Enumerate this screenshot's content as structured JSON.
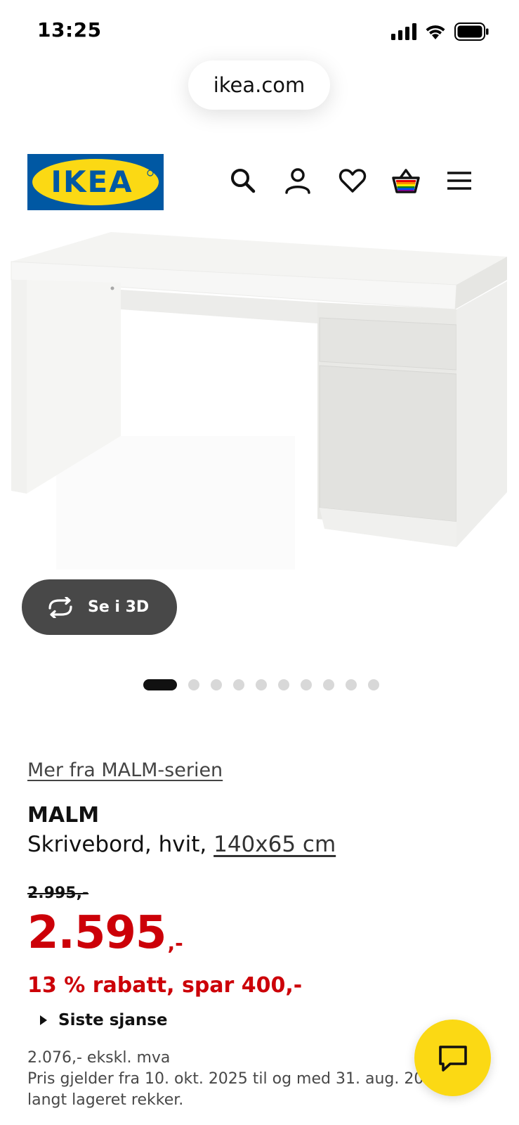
{
  "status_bar": {
    "time": "13:25",
    "icons": [
      "signal-icon",
      "wifi-icon",
      "battery-icon"
    ]
  },
  "browser": {
    "url": "ikea.com"
  },
  "header": {
    "logo_text": "IKEA",
    "logo_colors": {
      "background": "#0058a3",
      "oval": "#fbd914",
      "text": "#0058a3"
    },
    "nav_icons": [
      "search-icon",
      "account-icon",
      "heart-icon",
      "basket-icon",
      "menu-icon"
    ]
  },
  "gallery": {
    "view_3d_label": "Se i 3D",
    "dot_count": 10,
    "active_index": 0
  },
  "product": {
    "series_link": "Mer fra MALM-serien",
    "name": "MALM",
    "description_prefix": "Skrivebord, hvit, ",
    "size_link": "140x65 cm",
    "old_price": "2.995,-",
    "price_main": "2.595",
    "price_suffix": ",-",
    "discount_text": "13 % rabatt, spar 400,-",
    "last_chance_label": "Siste sjanse",
    "excl_vat": "2.076,- ekskl. mva",
    "validity_line1": "Pris gjelder fra 10. okt. 2025 til og med 31. aug. 202",
    "validity_line2": "langt lageret rekker."
  },
  "colors": {
    "price_red": "#cc0008",
    "chat_yellow": "#fbd914",
    "dark_button": "#484848"
  },
  "chat": {
    "icon": "chat-icon"
  }
}
